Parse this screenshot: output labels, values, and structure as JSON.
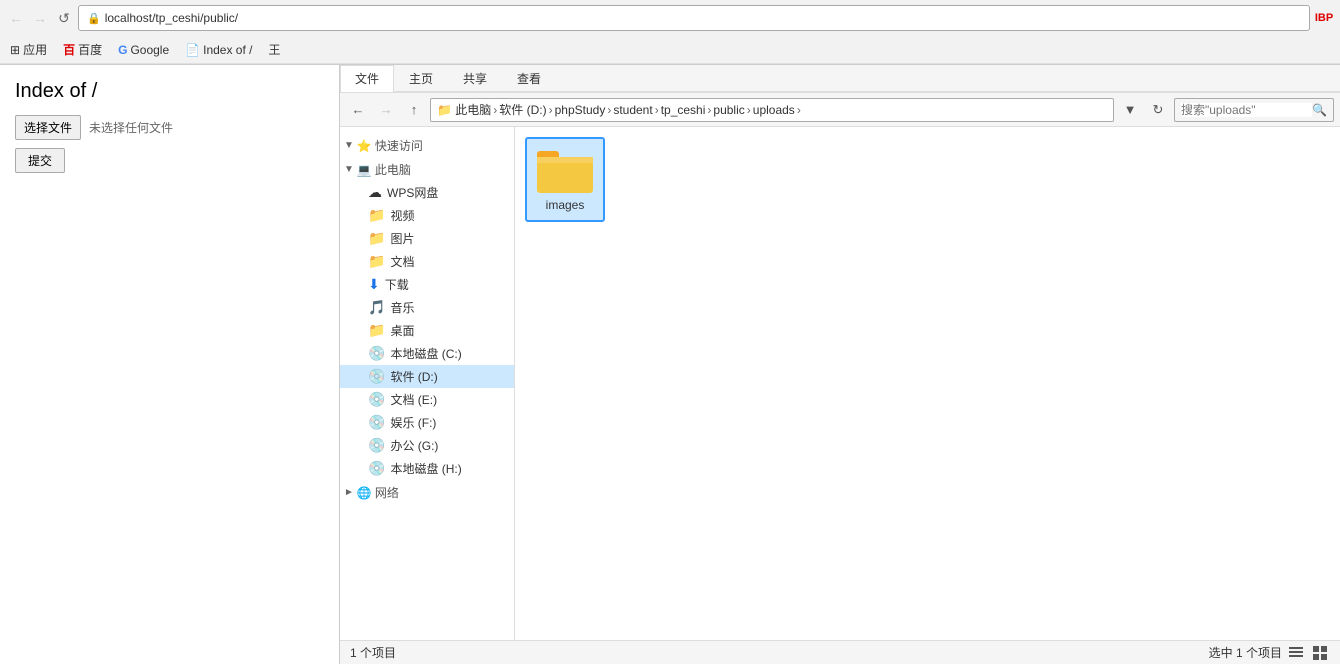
{
  "browser": {
    "address": "localhost/tp_ceshi/public/",
    "back_label": "←",
    "forward_label": "→",
    "reload_label": "↺",
    "bookmarks": [
      {
        "label": "应用",
        "icon": "⊞"
      },
      {
        "label": "百度",
        "icon": "●"
      },
      {
        "label": "Google",
        "icon": "G"
      },
      {
        "label": "Index of /",
        "icon": "📄"
      },
      {
        "label": "王",
        "icon": "王"
      }
    ]
  },
  "webpage": {
    "title": "Index of /",
    "file_choose_label": "选择文件",
    "file_no_chosen": "未选择任何文件",
    "submit_label": "提交"
  },
  "explorer": {
    "ribbon": {
      "tabs": [
        "文件",
        "主页",
        "共享",
        "查看"
      ],
      "active_tab": "文件"
    },
    "address": {
      "breadcrumbs": [
        "此电脑",
        "软件 (D:)",
        "phpStudy",
        "student",
        "tp_ceshi",
        "public",
        "uploads"
      ],
      "search_placeholder": "搜索\"uploads\""
    },
    "nav_items": [
      {
        "label": "快速访问",
        "icon": "⭐",
        "type": "header"
      },
      {
        "label": "此电脑",
        "icon": "💻",
        "type": "header"
      },
      {
        "label": "WPS网盘",
        "icon": "☁",
        "type": "item"
      },
      {
        "label": "视频",
        "icon": "📁",
        "type": "item"
      },
      {
        "label": "图片",
        "icon": "📁",
        "type": "item"
      },
      {
        "label": "文档",
        "icon": "📁",
        "type": "item"
      },
      {
        "label": "下载",
        "icon": "⬇",
        "type": "item"
      },
      {
        "label": "音乐",
        "icon": "🎵",
        "type": "item"
      },
      {
        "label": "桌面",
        "icon": "📁",
        "type": "item"
      },
      {
        "label": "本地磁盘 (C:)",
        "icon": "💿",
        "type": "item"
      },
      {
        "label": "软件 (D:)",
        "icon": "💿",
        "type": "item",
        "selected": true
      },
      {
        "label": "文档 (E:)",
        "icon": "💿",
        "type": "item"
      },
      {
        "label": "娱乐 (F:)",
        "icon": "💿",
        "type": "item"
      },
      {
        "label": "办公 (G:)",
        "icon": "💿",
        "type": "item"
      },
      {
        "label": "本地磁盘 (H:)",
        "icon": "💿",
        "type": "item"
      },
      {
        "label": "网络",
        "icon": "🌐",
        "type": "header"
      }
    ],
    "folder_items": [
      {
        "name": "images",
        "selected": true
      }
    ],
    "status": {
      "left": "1 个项目",
      "right": "选中 1 个项目"
    }
  }
}
